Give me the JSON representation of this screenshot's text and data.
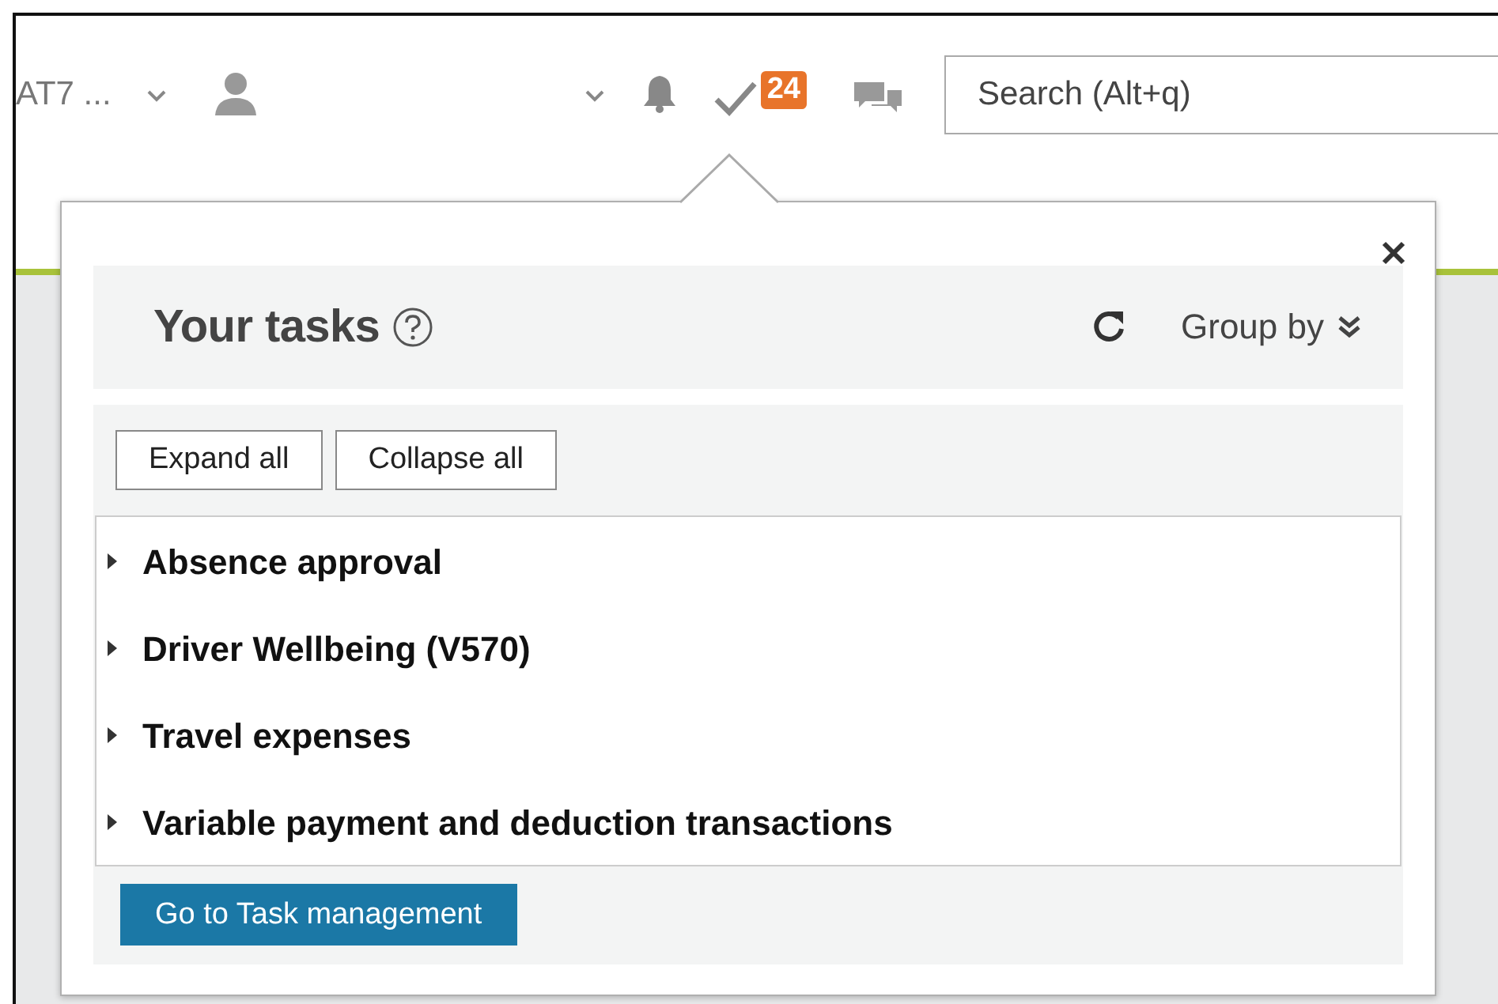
{
  "header": {
    "account": "AT7 ...",
    "task_count": "24",
    "search": {
      "placeholder": "Search (Alt+q)"
    }
  },
  "tasks_popup": {
    "title": "Your tasks",
    "group_by": "Group by",
    "buttons": [
      "Expand all",
      "Collapse all"
    ],
    "task_groups": [
      {
        "label": "Absence approval",
        "expanded": false
      },
      {
        "label": "Driver Wellbeing (V570)",
        "expanded": false
      },
      {
        "label": "Travel expenses",
        "expanded": false
      },
      {
        "label": "Variable payment and deduction transactions",
        "expanded": false
      }
    ],
    "footer_button": "Go to Task management"
  }
}
